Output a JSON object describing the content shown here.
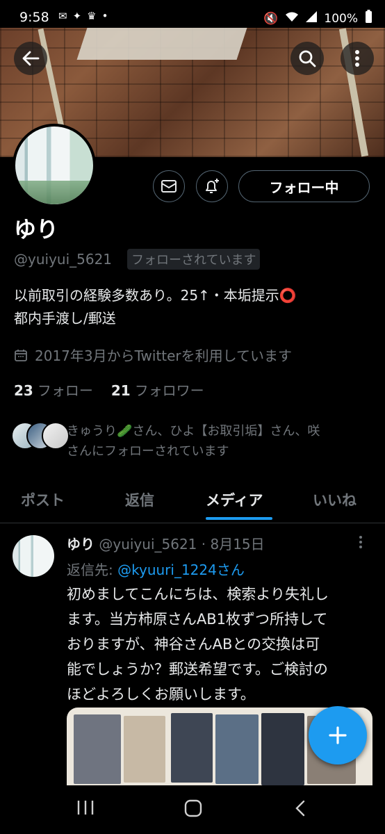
{
  "status_bar": {
    "time": "9:58",
    "battery": "100%"
  },
  "profile": {
    "name": "ゆり",
    "handle": "@yuiyui_5621",
    "follows_you": "フォローされています",
    "bio_line1": "以前取引の経験多数あり。25↑・本垢提示⭕",
    "bio_line2": "都内手渡し/郵送",
    "joined": "2017年3月からTwitterを利用しています",
    "following_count": "23",
    "following_label": "フォロー",
    "followers_count": "21",
    "followers_label": "フォロワー",
    "known_followers_line1": "きゅうり🥒さん、ひよ【お取引垢】さん、咲",
    "known_followers_line2": "さんにフォローされています",
    "follow_button": "フォロー中"
  },
  "tabs": [
    {
      "label": "ポスト"
    },
    {
      "label": "返信"
    },
    {
      "label": "メディア"
    },
    {
      "label": "いいね"
    }
  ],
  "post": {
    "name": "ゆり",
    "handle_date": "@yuiyui_5621 · 8月15日",
    "reply_prefix": "返信先: ",
    "reply_handle": "@kyuuri_1224さん",
    "text_lines": [
      "初めましてこんにちは、検索より失礼し",
      "ます。当方柿原さんAB1枚ずつ所持して",
      "おりますが、神谷さんABとの交換は可",
      "能でしょうか？郵送希望です。ご検討の",
      "ほどよろしくお願いします。"
    ]
  },
  "fab": {
    "label": "+"
  },
  "colors": {
    "accent": "#1d9bf0",
    "background": "#000000",
    "muted": "#71767b",
    "text": "#e7e9ea"
  }
}
